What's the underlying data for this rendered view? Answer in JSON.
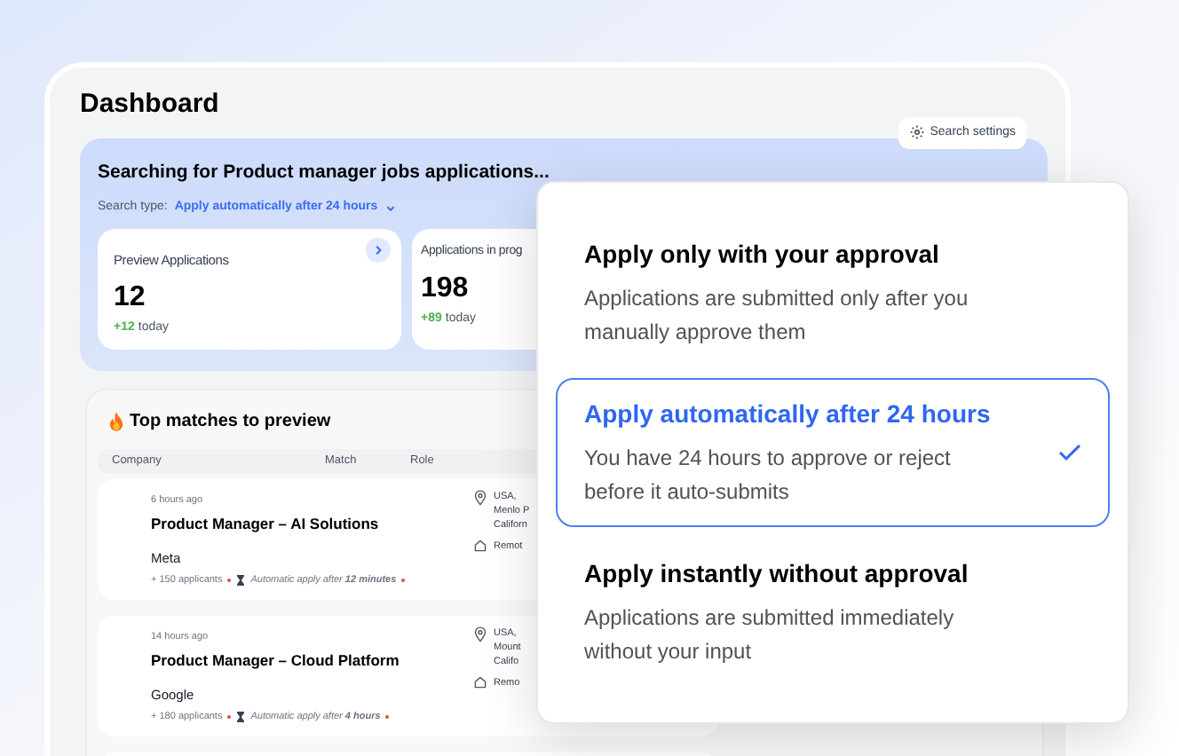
{
  "dashboard": {
    "title": "Dashboard",
    "search_settings": "Search settings"
  },
  "banner": {
    "heading": "Searching for Product manager jobs applications...",
    "search_type_label": "Search type:",
    "search_type_value": "Apply automatically after 24 hours"
  },
  "stats": [
    {
      "label": "Preview Applications",
      "value": "12",
      "delta": "+12",
      "delta_suffix": "today",
      "kind": "link"
    },
    {
      "label": "Applications in prog",
      "value": "198",
      "delta": "+89",
      "delta_suffix": "today",
      "kind": "plain"
    }
  ],
  "matches": {
    "title": "Top matches to preview",
    "columns": [
      "Company",
      "Match",
      "Role"
    ],
    "rows": [
      {
        "time": "6 hours ago",
        "title": "Product Manager – AI Solutions",
        "company": "Meta",
        "applicants": "+ 150 applicants",
        "auto_apply": "Automatic apply after **12 minutes**",
        "location": [
          "USA,",
          "Menlo P",
          "Californ"
        ],
        "work_mode": "Remot"
      },
      {
        "time": "14 hours ago",
        "title": "Product Manager – Cloud Platform",
        "company": "Google",
        "applicants": "+ 180 applicants",
        "auto_apply": "Automatic apply after **4 hours**",
        "location": [
          "USA,",
          "Mount",
          "Califo"
        ],
        "work_mode": "Remo"
      }
    ]
  },
  "options": [
    {
      "title": "Apply only with your approval",
      "description": "Applications are submitted only after you manually approve them",
      "selected": false
    },
    {
      "title": "Apply automatically after 24 hours",
      "description": "You have 24 hours to approve or reject before it auto-submits",
      "selected": true
    },
    {
      "title": "Apply instantly without approval",
      "description": "Applications are submitted immediately without your input",
      "selected": false
    }
  ]
}
